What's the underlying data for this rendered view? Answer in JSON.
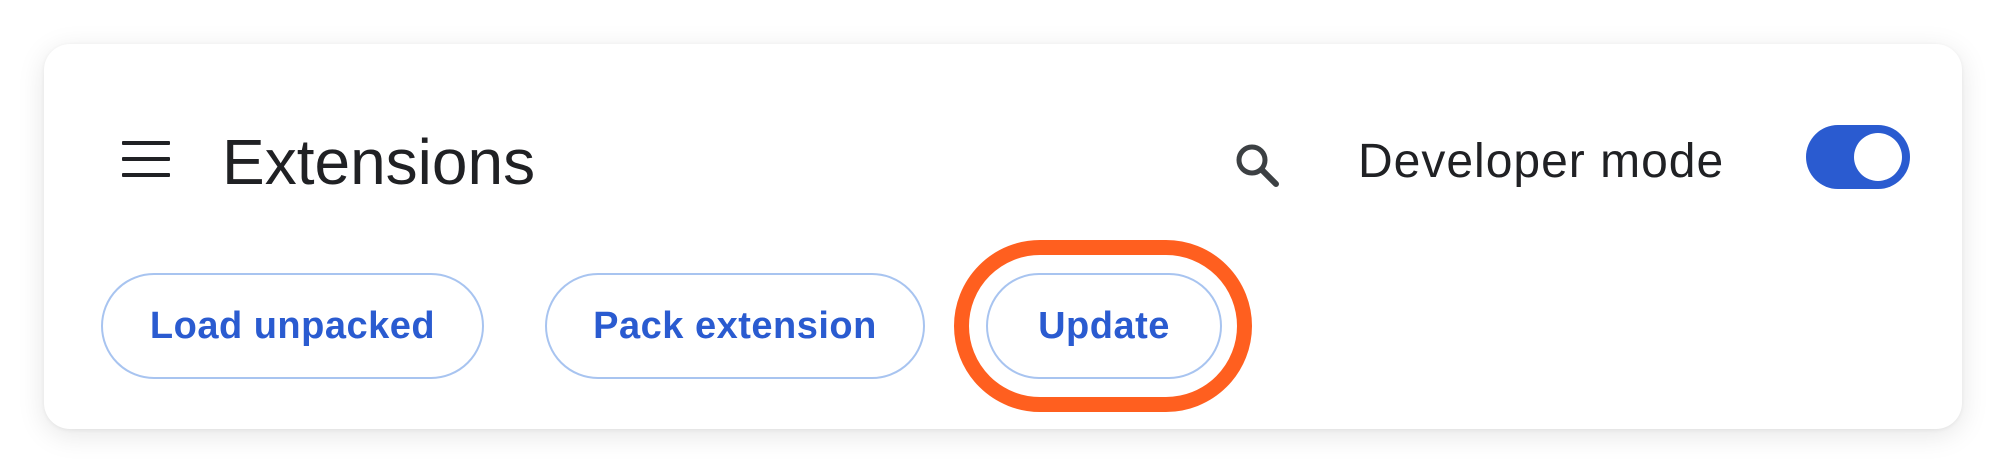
{
  "header": {
    "menu_icon": "hamburger-menu-icon",
    "title": "Extensions",
    "search_icon": "search-icon",
    "developer_mode_label": "Developer mode",
    "developer_mode_enabled": true
  },
  "toolbar": {
    "load_unpacked_label": "Load unpacked",
    "pack_extension_label": "Pack extension",
    "update_label": "Update"
  },
  "colors": {
    "accent": "#2a5bd0",
    "button_border": "#a8c4f0",
    "highlight": "#ff5f1f",
    "text": "#202124"
  }
}
